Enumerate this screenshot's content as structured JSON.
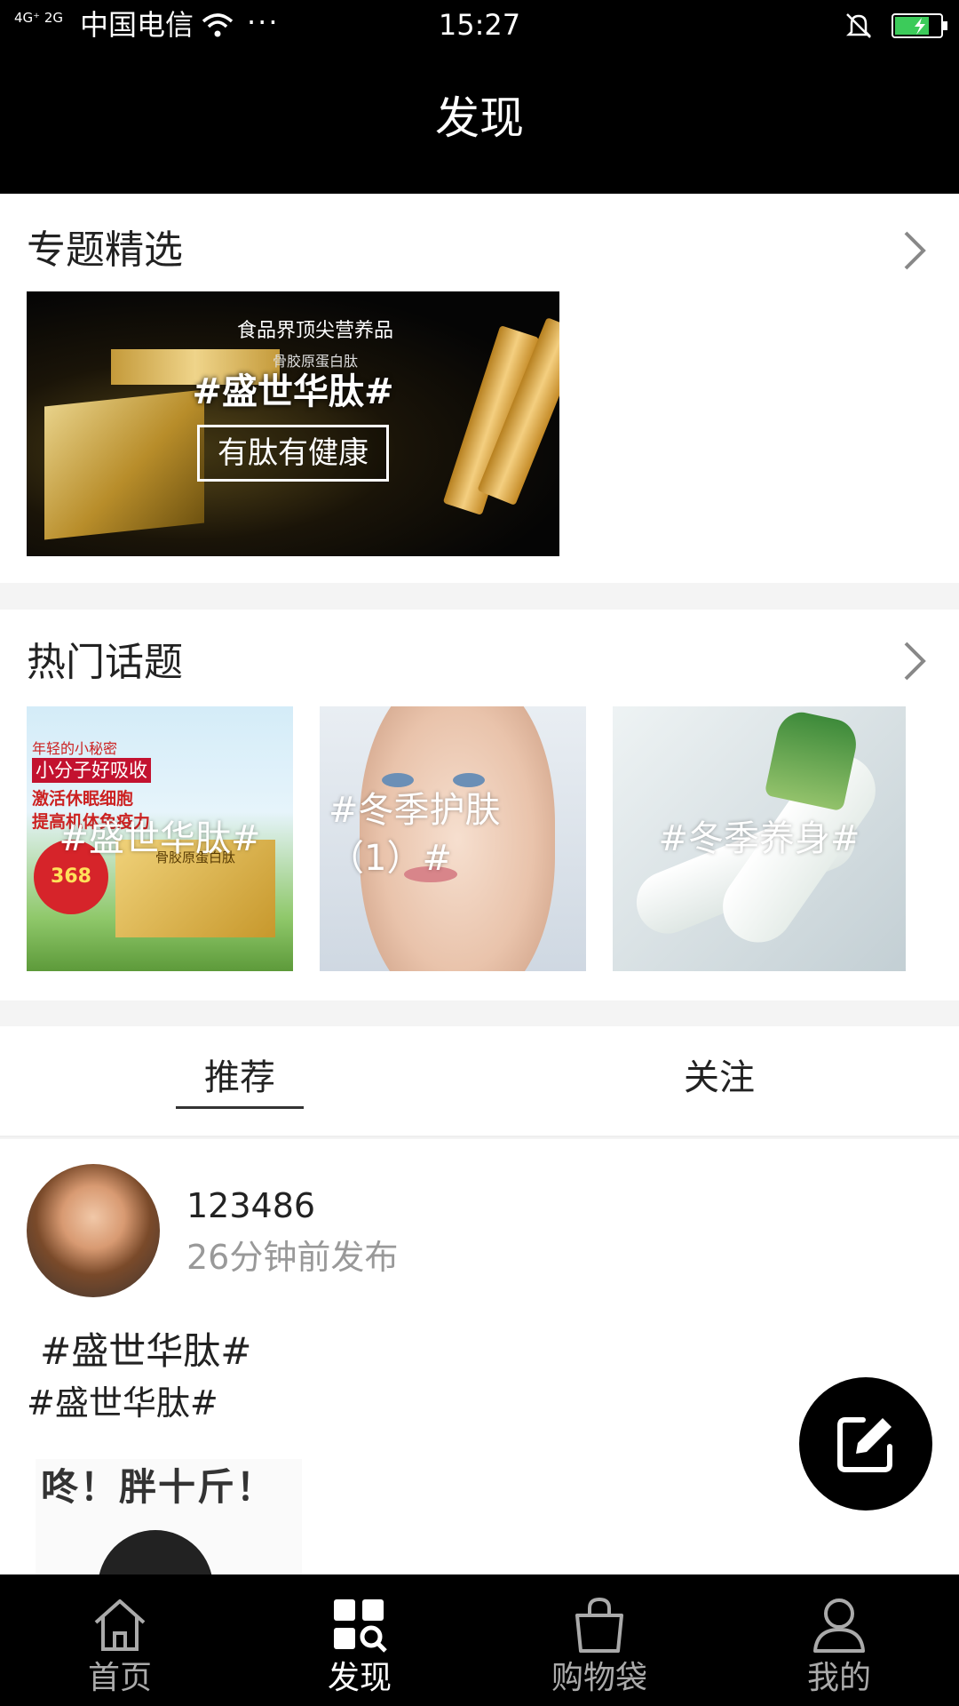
{
  "status_bar": {
    "network": "4G⁺ 2G",
    "carrier": "中国电信",
    "more": "···",
    "time": "15:27"
  },
  "header": {
    "title": "发现"
  },
  "featured": {
    "title": "专题精选",
    "banner": {
      "headline": "食品界顶尖营养品",
      "subhead": "骨胶原蛋白肽",
      "hashtag": "#盛世华肽#",
      "slogan": "有肽有健康"
    }
  },
  "hot_topics": {
    "title": "热门话题",
    "items": [
      {
        "label": "#盛世华肽#",
        "image_text": [
          "年轻的小秘密",
          "小分子好吸收",
          "激活休眠细胞",
          "提高机体免疫力"
        ],
        "price": "368",
        "product": "骨胶原蛋白肽"
      },
      {
        "label": "#冬季护肤（1）#"
      },
      {
        "label": "#冬季养身#"
      }
    ]
  },
  "feed_tabs": [
    {
      "label": "推荐",
      "active": true
    },
    {
      "label": "关注",
      "active": false
    }
  ],
  "post": {
    "username": "123486",
    "time": "26分钟前发布",
    "tag_title": "#盛世华肽#",
    "tag_body": "#盛世华肽#",
    "image_text": "咚！胖十斤！"
  },
  "bottom_nav": [
    {
      "label": "首页",
      "icon": "home-icon",
      "active": false
    },
    {
      "label": "发现",
      "icon": "discover-icon",
      "active": true
    },
    {
      "label": "购物袋",
      "icon": "shopping-bag-icon",
      "active": false
    },
    {
      "label": "我的",
      "icon": "user-icon",
      "active": false
    }
  ]
}
